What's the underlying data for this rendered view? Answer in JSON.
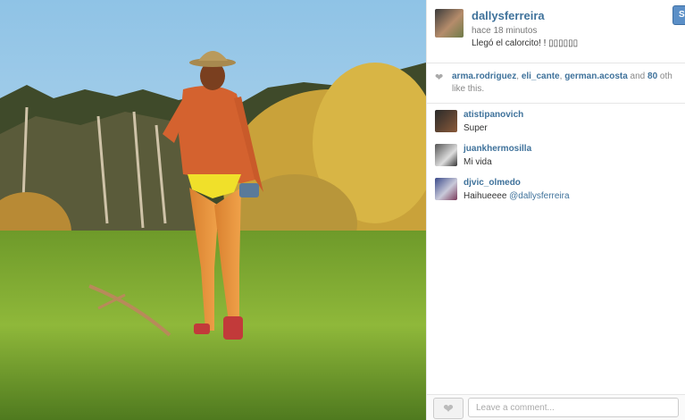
{
  "post": {
    "username": "dallysferreira",
    "time": "hace 18 minutos",
    "caption": "Llegó el calorcito! ! ▯▯▯▯▯▯"
  },
  "follow_label": "Se",
  "likes": {
    "users": [
      "arma.rodriguez",
      "eli_cante",
      "german.acosta"
    ],
    "and_text": " and ",
    "count": "80",
    "others": " oth",
    "suffix": "like this.",
    "sep": ", "
  },
  "comments": [
    {
      "user": "atistipanovich",
      "text": "Super"
    },
    {
      "user": "juankhermosilla",
      "text": "Mi vida"
    },
    {
      "user": "djvic_olmedo",
      "text": "Haihueeee ",
      "mention": "@dallysferreira"
    }
  ],
  "comment_input": {
    "placeholder": "Leave a comment..."
  },
  "colors": {
    "link": "#3f729b",
    "follow_button": "#5b8fc7"
  }
}
